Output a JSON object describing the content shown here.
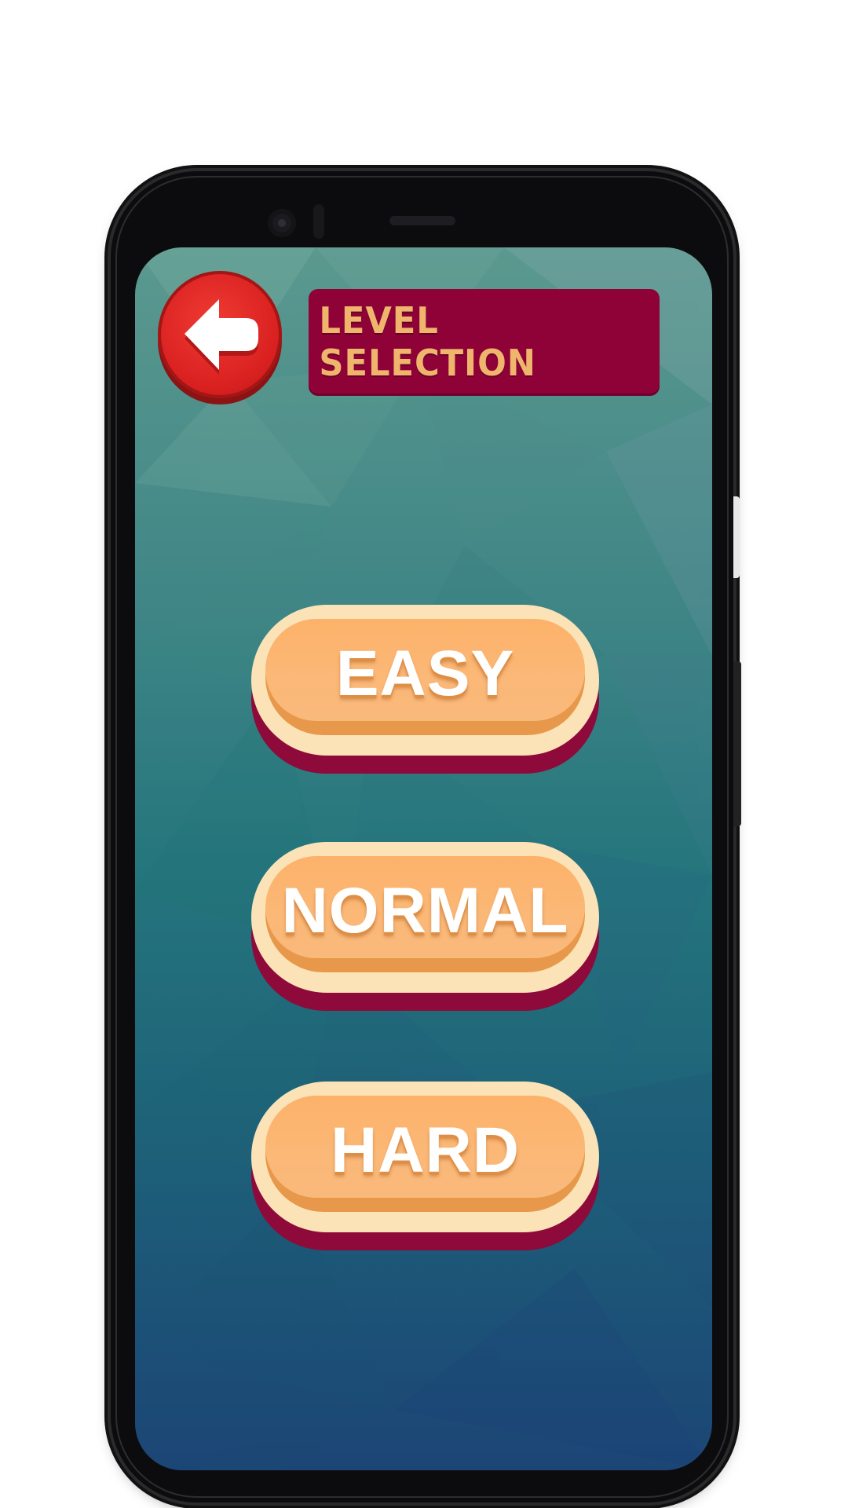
{
  "header": {
    "title": "LEVEL SELECTION"
  },
  "levels": [
    {
      "label": "EASY"
    },
    {
      "label": "NORMAL"
    },
    {
      "label": "HARD"
    }
  ],
  "colors": {
    "title_banner": "#8e0238",
    "title_text": "#efb56d",
    "back_button": "#d92020",
    "level_button_face": "#fbb877",
    "level_button_rim": "#fbe3b7",
    "level_button_base": "#8d0a3a",
    "screen_top": "#5b998f",
    "screen_bottom": "#1c4576"
  },
  "icons": {
    "back": "arrow-left-icon"
  }
}
